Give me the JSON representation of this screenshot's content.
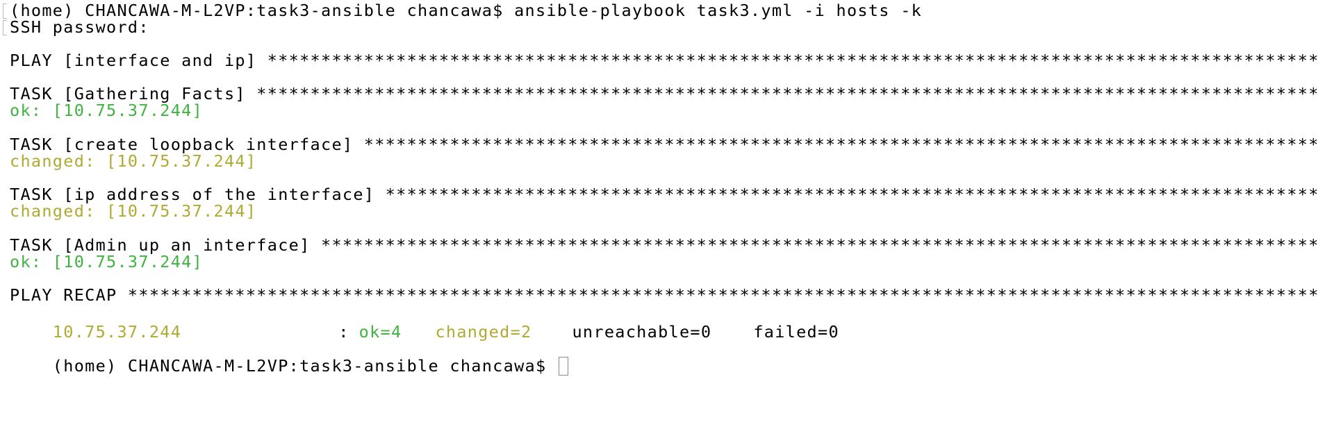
{
  "terminal": {
    "prompt_line": "(home) CHANCAWA-M-L2VP:task3-ansible chancawa$ ansible-playbook task3.yml -i hosts -k",
    "ssh_prompt": "SSH password:",
    "play_header": "PLAY [interface and ip] *********************************************************************************************************",
    "task1_header": "TASK [Gathering Facts] **********************************************************************************************************",
    "task1_result": "ok: [10.75.37.244]",
    "task2_header": "TASK [create loopback interface] ************************************************************************************************",
    "task2_result": "changed: [10.75.37.244]",
    "task3_header": "TASK [ip address of the interface] **********************************************************************************************",
    "task3_result": "changed: [10.75.37.244]",
    "task4_header": "TASK [Admin up an interface] ****************************************************************************************************",
    "task4_result": "ok: [10.75.37.244]",
    "recap_header": "PLAY RECAP **********************************************************************************************************************",
    "recap": {
      "host": "10.75.37.244",
      "separator": ":",
      "ok": "ok=4",
      "changed": "changed=2",
      "unreachable": "unreachable=0",
      "failed": "failed=0"
    },
    "final_prompt": "(home) CHANCAWA-M-L2VP:task3-ansible chancawa$ ",
    "colors": {
      "ok": "#3fb33f",
      "changed": "#b0a931",
      "text": "#000000",
      "background": "#ffffff"
    }
  }
}
